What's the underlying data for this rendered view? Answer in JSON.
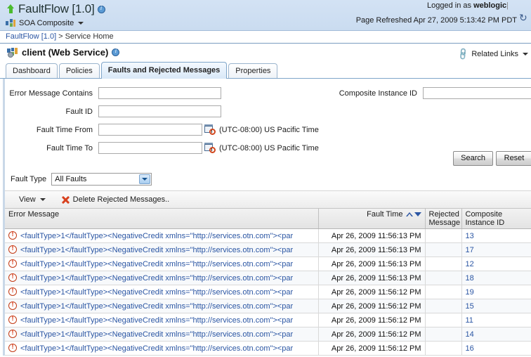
{
  "banner": {
    "app_title": "FaultFlow [1.0]",
    "info_icon": "info-icon",
    "up_icon": "up-arrow-icon",
    "composite_label": "SOA Composite",
    "composite_icon": "soa-composite-icon",
    "logged_in_prefix": "Logged in as",
    "logged_in_user": "weblogic",
    "logged_in_sep": "|",
    "page_refreshed": "Page Refreshed Apr 27, 2009 5:13:42 PM PDT",
    "refresh_icon": "refresh-icon"
  },
  "breadcrumb": {
    "root": "FaultFlow [1.0]",
    "separator": ">",
    "current": "Service Home"
  },
  "page_header": {
    "title": "client (Web Service)",
    "title_icon": "web-service-icon",
    "info_icon": "info-icon",
    "related_links": "Related Links",
    "related_links_icon": "link-icon"
  },
  "tabs": [
    {
      "label": "Dashboard",
      "active": false
    },
    {
      "label": "Policies",
      "active": false
    },
    {
      "label": "Faults and Rejected Messages",
      "active": true
    },
    {
      "label": "Properties",
      "active": false
    }
  ],
  "search": {
    "error_message_contains": {
      "label": "Error Message Contains",
      "value": ""
    },
    "fault_id": {
      "label": "Fault ID",
      "value": ""
    },
    "fault_time_from": {
      "label": "Fault Time From",
      "value": "",
      "timezone": "(UTC-08:00) US Pacific Time",
      "calendar_icon": "calendar-clock-icon"
    },
    "fault_time_to": {
      "label": "Fault Time To",
      "value": "",
      "timezone": "(UTC-08:00) US Pacific Time",
      "calendar_icon": "calendar-clock-icon"
    },
    "composite_instance_id": {
      "label": "Composite Instance ID",
      "value": ""
    },
    "search_button": "Search",
    "reset_button": "Reset",
    "fault_type": {
      "label": "Fault Type",
      "selected": "All Faults"
    }
  },
  "toolbar": {
    "view_label": "View",
    "delete_label": "Delete Rejected Messages..",
    "delete_icon": "red-x-icon"
  },
  "table": {
    "columns": {
      "error_message": "Error Message",
      "fault_time": "Fault Time",
      "rejected_message": "Rejected Message",
      "composite_instance_id": "Composite Instance ID"
    },
    "sort": {
      "column": "Fault Time",
      "ascending_icon": "sort-ascending-icon",
      "descending_icon": "sort-descending-icon"
    },
    "rows": [
      {
        "error_message": "<faultType>1</faultType><NegativeCredit xmlns=\"http://services.otn.com\"><par",
        "fault_time": "Apr 26, 2009 11:56:13 PM",
        "rejected_message": "",
        "composite_instance_id": "13"
      },
      {
        "error_message": "<faultType>1</faultType><NegativeCredit xmlns=\"http://services.otn.com\"><par",
        "fault_time": "Apr 26, 2009 11:56:13 PM",
        "rejected_message": "",
        "composite_instance_id": "17"
      },
      {
        "error_message": "<faultType>1</faultType><NegativeCredit xmlns=\"http://services.otn.com\"><par",
        "fault_time": "Apr 26, 2009 11:56:13 PM",
        "rejected_message": "",
        "composite_instance_id": "12"
      },
      {
        "error_message": "<faultType>1</faultType><NegativeCredit xmlns=\"http://services.otn.com\"><par",
        "fault_time": "Apr 26, 2009 11:56:13 PM",
        "rejected_message": "",
        "composite_instance_id": "18"
      },
      {
        "error_message": "<faultType>1</faultType><NegativeCredit xmlns=\"http://services.otn.com\"><par",
        "fault_time": "Apr 26, 2009 11:56:12 PM",
        "rejected_message": "",
        "composite_instance_id": "19"
      },
      {
        "error_message": "<faultType>1</faultType><NegativeCredit xmlns=\"http://services.otn.com\"><par",
        "fault_time": "Apr 26, 2009 11:56:12 PM",
        "rejected_message": "",
        "composite_instance_id": "15"
      },
      {
        "error_message": "<faultType>1</faultType><NegativeCredit xmlns=\"http://services.otn.com\"><par",
        "fault_time": "Apr 26, 2009 11:56:12 PM",
        "rejected_message": "",
        "composite_instance_id": "11"
      },
      {
        "error_message": "<faultType>1</faultType><NegativeCredit xmlns=\"http://services.otn.com\"><par",
        "fault_time": "Apr 26, 2009 11:56:12 PM",
        "rejected_message": "",
        "composite_instance_id": "14"
      },
      {
        "error_message": "<faultType>1</faultType><NegativeCredit xmlns=\"http://services.otn.com\"><par",
        "fault_time": "Apr 26, 2009 11:56:12 PM",
        "rejected_message": "",
        "composite_instance_id": "16"
      }
    ]
  },
  "colors": {
    "banner_bg": "#cfe0f3",
    "link": "#2a55a3",
    "error_red": "#d8411f",
    "active_tab_bg": "#d8e8f7"
  }
}
